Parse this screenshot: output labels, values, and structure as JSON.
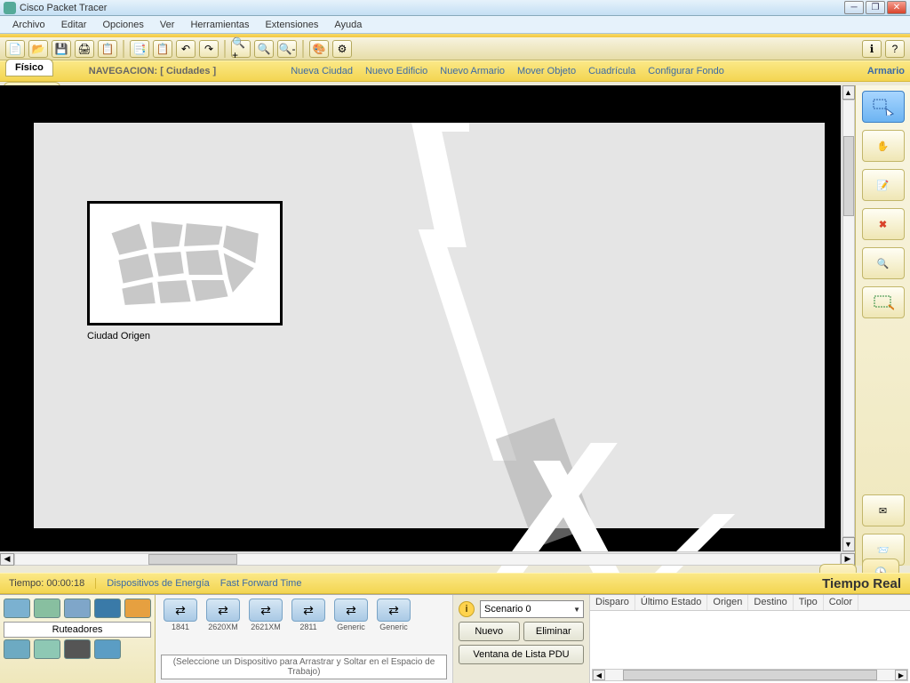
{
  "window": {
    "title": "Cisco Packet Tracer"
  },
  "menu": [
    "Archivo",
    "Editar",
    "Opciones",
    "Ver",
    "Herramientas",
    "Extensiones",
    "Ayuda"
  ],
  "nav": {
    "tab": "Físico",
    "label": "NAVEGACION: [ Ciudades ]",
    "links": [
      "Nueva Ciudad",
      "Nuevo Edificio",
      "Nuevo Armario",
      "Mover Objeto",
      "Cuadrícula",
      "Configurar Fondo"
    ],
    "right": "Armario"
  },
  "city": {
    "label": "Ciudad Origen"
  },
  "timebar": {
    "time": "Tiempo: 00:00:18",
    "links": [
      "Dispositivos de Energía",
      "Fast Forward Time"
    ],
    "rt": "Tiempo Real"
  },
  "categories": {
    "label": "Ruteadores"
  },
  "devices": [
    "1841",
    "2620XM",
    "2621XM",
    "2811",
    "Generic",
    "Generic"
  ],
  "device_desc": "(Seleccione un Dispositivo para Arrastrar y Soltar en el Espacio de Trabajo)",
  "scenario": {
    "selected": "Scenario 0",
    "new": "Nuevo",
    "del": "Eliminar",
    "pdu": "Ventana de Lista PDU"
  },
  "table_headers": [
    "Disparo",
    "Último Estado",
    "Origen",
    "Destino",
    "Tipo",
    "Color"
  ]
}
